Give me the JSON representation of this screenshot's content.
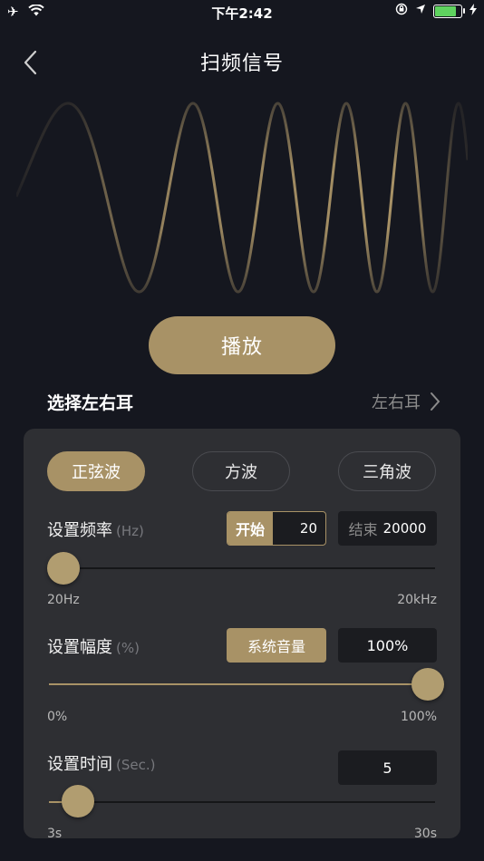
{
  "status_bar": {
    "time": "下午2:42",
    "left_icons": [
      "airplane-icon",
      "wifi-icon"
    ],
    "right_icons": [
      "rotation-lock-icon",
      "location-icon",
      "battery-icon",
      "charging-icon"
    ],
    "battery_level": 0.9,
    "battery_color": "#5fd35f"
  },
  "nav": {
    "title": "扫频信号",
    "back_icon": "chevron-left-icon"
  },
  "play_button": {
    "label": "播放"
  },
  "ear": {
    "label": "选择左右耳",
    "value": "左右耳"
  },
  "wave_types": {
    "items": [
      "正弦波",
      "方波",
      "三角波"
    ],
    "selected": 0
  },
  "frequency": {
    "label": "设置频率",
    "unit": "(Hz)",
    "start_label": "开始",
    "start_value": "20",
    "end_label": "结束",
    "end_value": "20000",
    "min_label": "20Hz",
    "max_label": "20kHz",
    "slider_value": 0
  },
  "amplitude": {
    "label": "设置幅度",
    "unit": "(%)",
    "system_volume_label": "系统音量",
    "value": "100%",
    "min_label": "0%",
    "max_label": "100%",
    "slider_value": 1
  },
  "duration": {
    "label": "设置时间",
    "unit": "(Sec.)",
    "value": "5",
    "min_label": "3s",
    "max_label": "30s",
    "slider_value": 0.074
  },
  "colors": {
    "accent": "#a89266",
    "background": "#15171f",
    "panel": "#2e2f33"
  }
}
